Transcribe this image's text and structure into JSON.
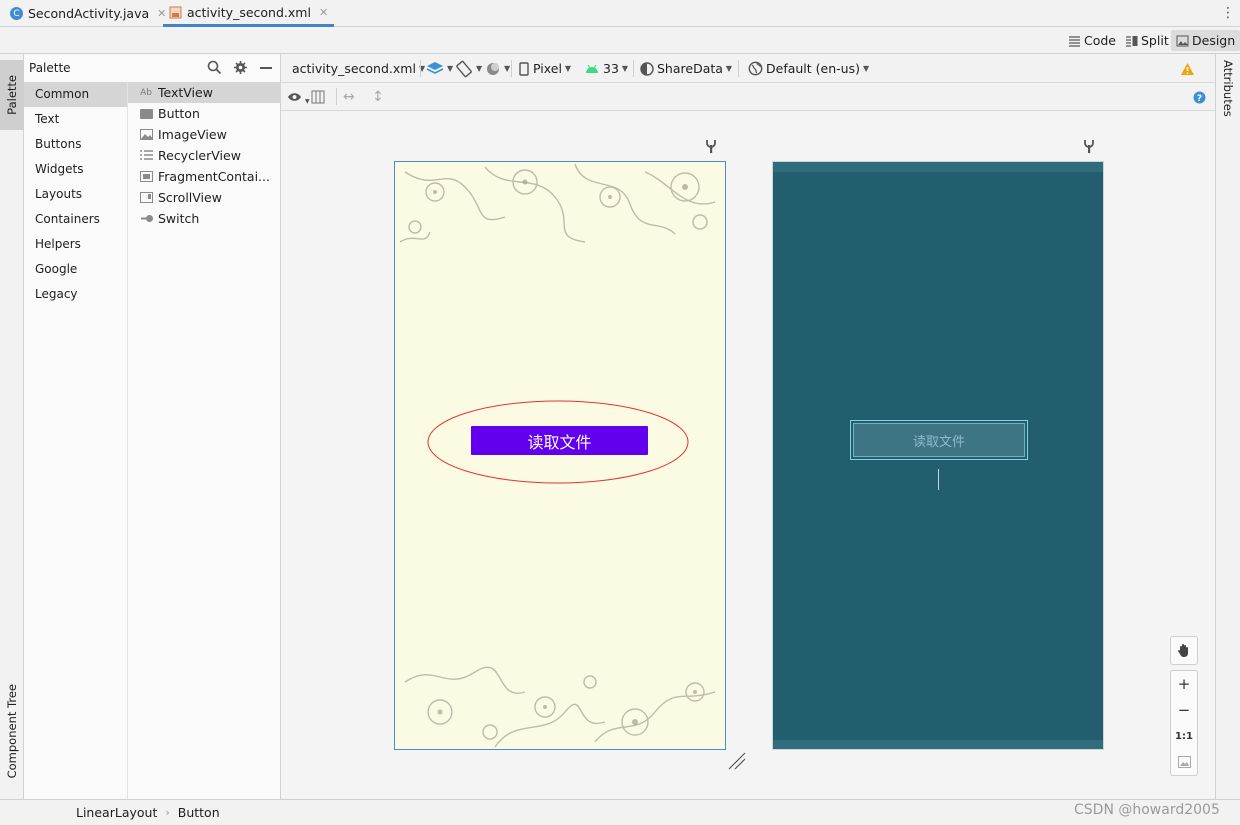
{
  "tabs": [
    {
      "label": "SecondActivity.java",
      "icon": "java-class-icon",
      "active": false
    },
    {
      "label": "activity_second.xml",
      "icon": "xml-layout-icon",
      "active": true
    }
  ],
  "view_modes": {
    "code": "Code",
    "split": "Split",
    "design": "Design",
    "active": "Design"
  },
  "left_tool_windows": {
    "palette": "Palette",
    "component_tree": "Component Tree"
  },
  "right_tool_windows": {
    "attributes": "Attributes"
  },
  "palette": {
    "title": "Palette",
    "categories": [
      "Common",
      "Text",
      "Buttons",
      "Widgets",
      "Layouts",
      "Containers",
      "Helpers",
      "Google",
      "Legacy"
    ],
    "selected_category": "Common",
    "items": [
      {
        "label": "TextView",
        "icon": "textview-icon",
        "glyph": "Ab"
      },
      {
        "label": "Button",
        "icon": "button-icon"
      },
      {
        "label": "ImageView",
        "icon": "imageview-icon"
      },
      {
        "label": "RecyclerView",
        "icon": "recyclerview-icon"
      },
      {
        "label": "FragmentContai...",
        "icon": "fragment-icon"
      },
      {
        "label": "ScrollView",
        "icon": "scrollview-icon"
      },
      {
        "label": "Switch",
        "icon": "switch-icon"
      }
    ],
    "selected_item": "TextView"
  },
  "design_toolbar": {
    "file": "activity_second.xml",
    "device": "Pixel",
    "api_level": "33",
    "theme": "ShareData",
    "locale": "Default (en-us)"
  },
  "design_preview": {
    "button_label": "读取文件"
  },
  "blueprint_preview": {
    "button_label": "读取文件"
  },
  "zoom_controls": {
    "one_to_one": "1:1"
  },
  "breadcrumb": [
    "LinearLayout",
    "Button"
  ],
  "watermark": "CSDN @howard2005",
  "colors": {
    "accent": "#4083c9",
    "button_primary": "#6200ee",
    "blueprint_bg": "#235e6f",
    "warning": "#f0a30a",
    "highlight_ellipse": "#e8322d"
  }
}
